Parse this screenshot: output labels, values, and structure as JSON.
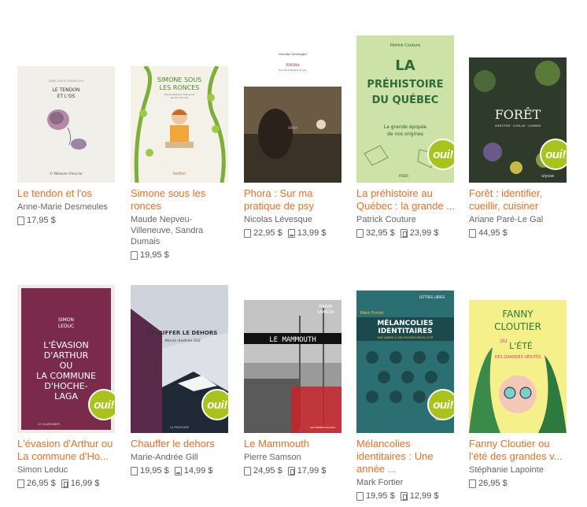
{
  "books": [
    {
      "title": "Le tendon et l'os",
      "author": "Anne-Marie Desmeules",
      "prices": [
        {
          "format": "paper",
          "value": "17,95 $"
        }
      ],
      "oui": false,
      "cover_text": [
        "LE TENDON",
        "ET L'OS",
        "© Mémoire d'encrier"
      ],
      "cover_color": "#f1efe9"
    },
    {
      "title": "Simone sous les ronces",
      "author": "Maude Nepveu-Villeneuve, Sandra Dumais",
      "prices": [
        {
          "format": "paper",
          "value": "19,95 $"
        }
      ],
      "oui": false,
      "cover_text": [
        "SIMONE SOUS",
        "LES RONCES",
        "Maude Nepveu-Villeneuve",
        "Sandra Dumais",
        "fonfon"
      ],
      "cover_color": "#f4f1e8"
    },
    {
      "title": "Phora : Sur ma pratique de psy",
      "author": "Nicolas Lévesque",
      "prices": [
        {
          "format": "paper",
          "value": "22,95 $"
        },
        {
          "format": "pdf",
          "value": "13,99 $"
        }
      ],
      "oui": false,
      "cover_text": [
        "Nicolas Lévesque",
        "PHORA",
        "Sur ma pratique de psy",
        "VARIA"
      ],
      "cover_color": "#3a3226"
    },
    {
      "title": "La préhistoire au Québec : la grande ...",
      "author": "Patrick Couture",
      "prices": [
        {
          "format": "paper",
          "value": "32,95 $"
        },
        {
          "format": "epub",
          "value": "23,99 $"
        }
      ],
      "oui": true,
      "cover_text": [
        "Patrick Couture",
        "LA",
        "PRÉHISTOIRE",
        "DU QUÉBEC",
        "La grande épopée",
        "de nos origines",
        "PIDER"
      ],
      "cover_color": "#cde2a6"
    },
    {
      "title": "Forêt : identifier, cueillir, cuisiner",
      "author": "Ariane Paré-Le Gal",
      "prices": [
        {
          "format": "paper",
          "value": "44,95 $"
        }
      ],
      "oui": true,
      "cover_text": [
        "FORÊT",
        "IDENTIFIER · CUEILLIR · CUISINER",
        "ulysse"
      ],
      "cover_color": "#2e3b2a"
    },
    {
      "title": "L'évasion d'Arthur ou La commune d'Ho...",
      "author": "Simon Leduc",
      "prices": [
        {
          "format": "paper",
          "value": "26,95 $"
        },
        {
          "format": "epub",
          "value": "16,99 $"
        }
      ],
      "oui": true,
      "cover_text": [
        "SIMON",
        "LEDUC",
        "L'ÉVASION",
        "D'ARTHUR",
        "OU",
        "LA COMMUNE",
        "D'HOCHE-",
        "LAGA",
        "LE QUARTANIER"
      ],
      "cover_color": "#7a2a4a"
    },
    {
      "title": "Chauffer le dehors",
      "author": "Marie-Andrée Gill",
      "prices": [
        {
          "format": "paper",
          "value": "19,95 $"
        },
        {
          "format": "pdf",
          "value": "14,99 $"
        }
      ],
      "oui": true,
      "cover_text": [
        "CHAUFFER LE DEHORS",
        "Marie-Andrée Gill",
        "LA PEUPLADE"
      ],
      "cover_color": "#dde0e6"
    },
    {
      "title": "Le Mammouth",
      "author": "Pierre Samson",
      "prices": [
        {
          "format": "paper",
          "value": "24,95 $"
        },
        {
          "format": "epub",
          "value": "17,99 $"
        }
      ],
      "oui": false,
      "cover_text": [
        "PIERRE",
        "SAMSON",
        "LE MAMMOUTH",
        "LES HERBES ROUGES"
      ],
      "cover_color": "#8c8c8c"
    },
    {
      "title": "Mélancolies identitaires : Une année ...",
      "author": "Mark Fortier",
      "prices": [
        {
          "format": "paper",
          "value": "19,95 $"
        },
        {
          "format": "epub",
          "value": "12,99 $"
        }
      ],
      "oui": true,
      "cover_text": [
        "LETTRES LIBRES",
        "Mark Fortier",
        "MÉLANCOLIES",
        "IDENTITAIRES",
        "UNE ANNÉE À LIRE MATHIEU BOCK-CÔTÉ",
        "LUX"
      ],
      "cover_color": "#2b6f72"
    },
    {
      "title": "Fanny Cloutier ou l'été des grandes v...",
      "author": "Stéphanie Lapointe",
      "prices": [
        {
          "format": "paper",
          "value": "26,95 $"
        }
      ],
      "oui": false,
      "cover_text": [
        "FANNY",
        "CLOUTIER",
        "OU",
        "L'ÉTÉ",
        "DES GRANDES VÉRITÉS"
      ],
      "cover_color": "#f6f08a"
    }
  ],
  "badge_label": "oui!"
}
